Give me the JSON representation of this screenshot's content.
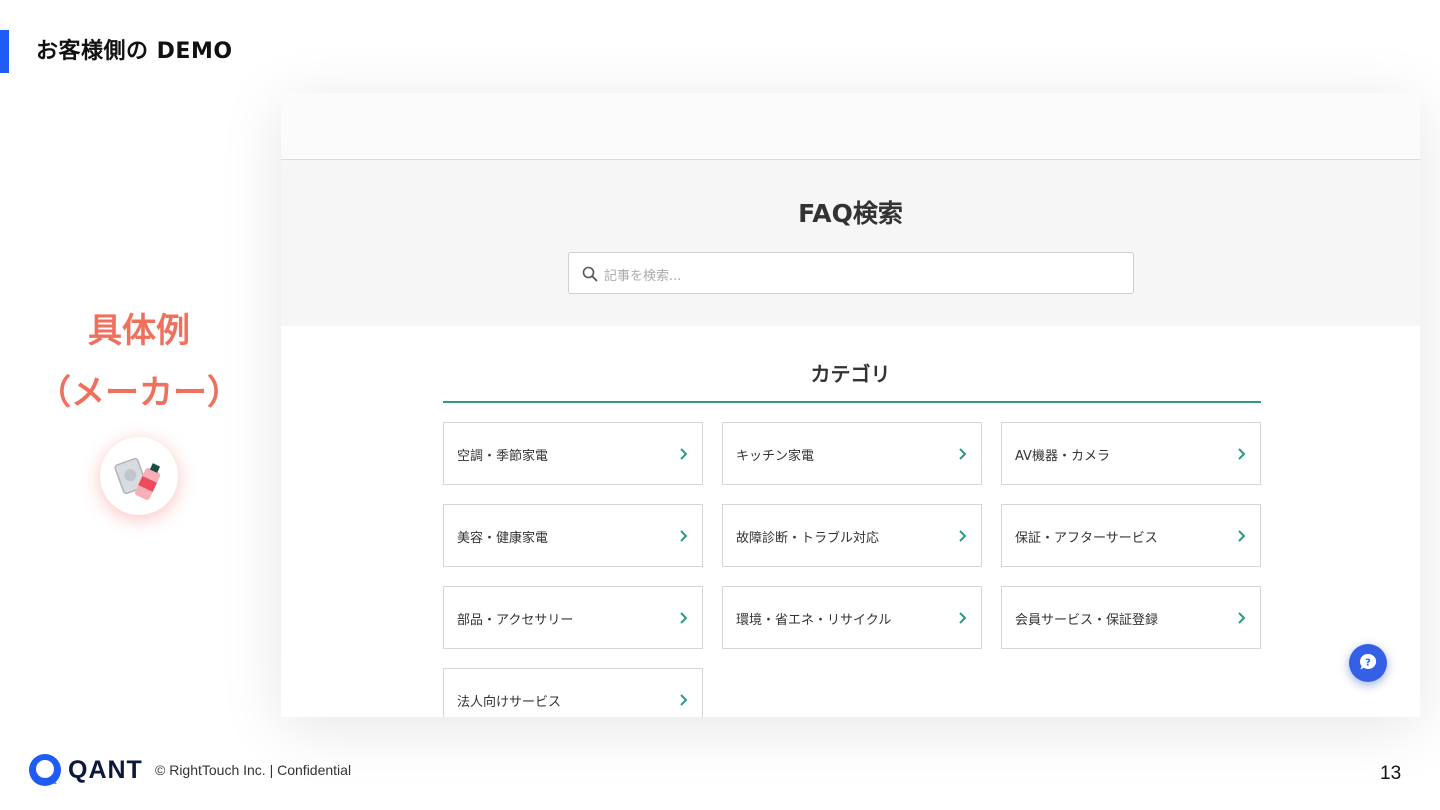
{
  "slide": {
    "title": "お客様側の DEMO",
    "accent_color": "#1f5bf5"
  },
  "left_panel": {
    "line1": "具体例",
    "line2": "（メーカー）",
    "label_color": "#f0705e",
    "badge_icon": "appliance-products-icon"
  },
  "embedded_page": {
    "hero_title": "FAQ検索",
    "search": {
      "placeholder": "記事を検索..."
    },
    "section_title": "カテゴリ",
    "accent_color": "#2d9b83",
    "categories": [
      {
        "label": "空調・季節家電"
      },
      {
        "label": "キッチン家電"
      },
      {
        "label": "AV機器・カメラ"
      },
      {
        "label": "美容・健康家電"
      },
      {
        "label": "故障診断・トラブル対応"
      },
      {
        "label": "保証・アフターサービス"
      },
      {
        "label": "部品・アクセサリー"
      },
      {
        "label": "環境・省エネ・リサイクル"
      },
      {
        "label": "会員サービス・保証登録"
      },
      {
        "label": "法人向けサービス"
      }
    ],
    "chat_button_icon": "chat-help-icon",
    "chat_button_color": "#3560e6"
  },
  "footer": {
    "brand": "QANT",
    "copyright": "© RightTouch Inc.  |  Confidential",
    "page_number": "13"
  }
}
